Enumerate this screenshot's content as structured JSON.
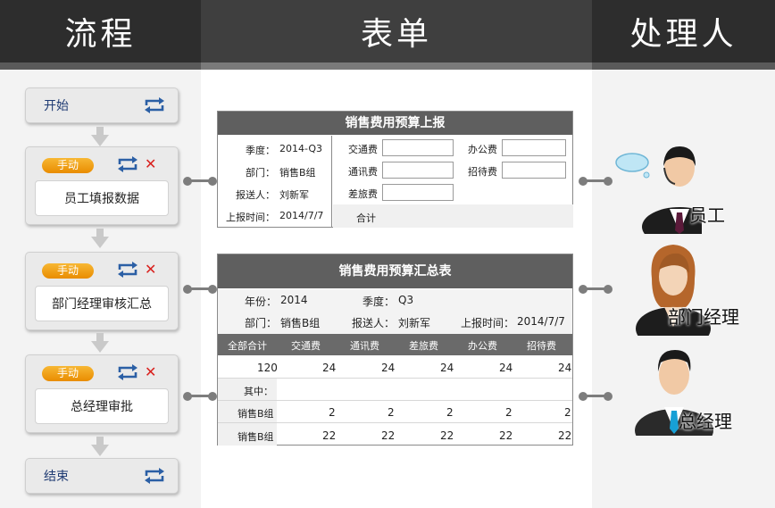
{
  "headers": {
    "flow": "流程",
    "form": "表单",
    "handler": "处理人"
  },
  "flow": {
    "start": "开始",
    "end": "结束",
    "badge": "手动",
    "steps": [
      "员工填报数据",
      "部门经理审核汇总",
      "总经理审批"
    ]
  },
  "form1": {
    "title": "销售费用预算上报",
    "season_label": "季度：",
    "season_value": "2014-Q3",
    "dept_label": "部门：",
    "dept_value": "销售B组",
    "reporter_label": "报送人：",
    "reporter_value": "刘新军",
    "time_label": "上报时间：",
    "time_value": "2014/7/7",
    "fields": [
      "交通费",
      "办公费",
      "通讯费",
      "招待费",
      "差旅费"
    ],
    "total_label": "合计"
  },
  "form2": {
    "title": "销售费用预算汇总表",
    "year_label": "年份：",
    "year_value": "2014",
    "season_label": "季度：",
    "season_value": "Q3",
    "dept_label": "部门：",
    "dept_value": "销售B组",
    "reporter_label": "报送人：",
    "reporter_value": "刘新军",
    "time_label": "上报时间：",
    "time_value": "2014/7/7",
    "columns": [
      "全部合计",
      "交通费",
      "通讯费",
      "差旅费",
      "办公费",
      "招待费"
    ],
    "total_row": [
      "120",
      "24",
      "24",
      "24",
      "24",
      "24"
    ],
    "sub_label": "其中：",
    "rows": [
      {
        "name": "销售B组",
        "values": [
          "2",
          "2",
          "2",
          "2",
          "2"
        ]
      },
      {
        "name": "销售B组",
        "values": [
          "22",
          "22",
          "22",
          "22",
          "22"
        ]
      }
    ]
  },
  "people": [
    "员工",
    "部门经理",
    "总经理"
  ],
  "colors": {
    "badge": "#f0a010",
    "header_dark": "#2d2d2d",
    "form_title": "#5f5f5f",
    "x_icon": "#d9211e"
  }
}
